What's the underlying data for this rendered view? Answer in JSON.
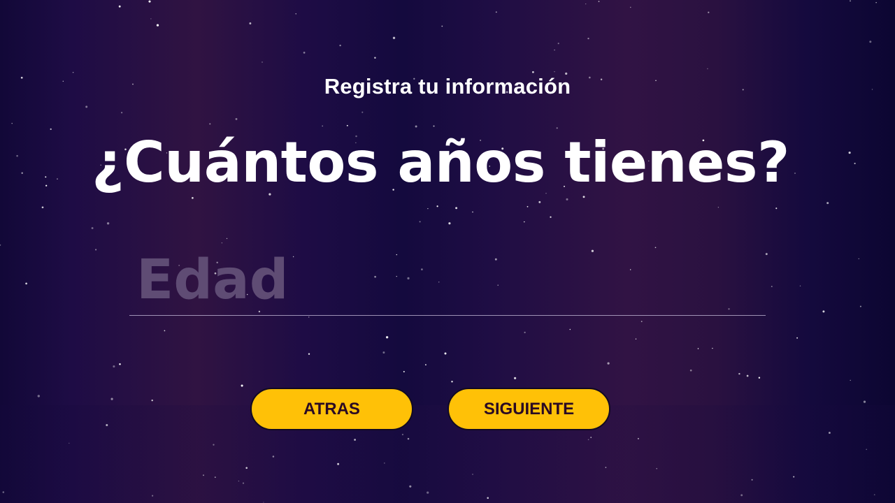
{
  "header": {
    "subtitle": "Registra tu información"
  },
  "main": {
    "question": "¿Cuántos años tienes?"
  },
  "age_field": {
    "value": "",
    "placeholder": "Edad"
  },
  "actions": {
    "back_label": "ATRAS",
    "next_label": "SIGUIENTE"
  },
  "colors": {
    "background": "#1a0b40",
    "accent": "#ffc107",
    "button_text": "#2a0a24",
    "placeholder": "#5f4c74",
    "text": "#ffffff"
  }
}
